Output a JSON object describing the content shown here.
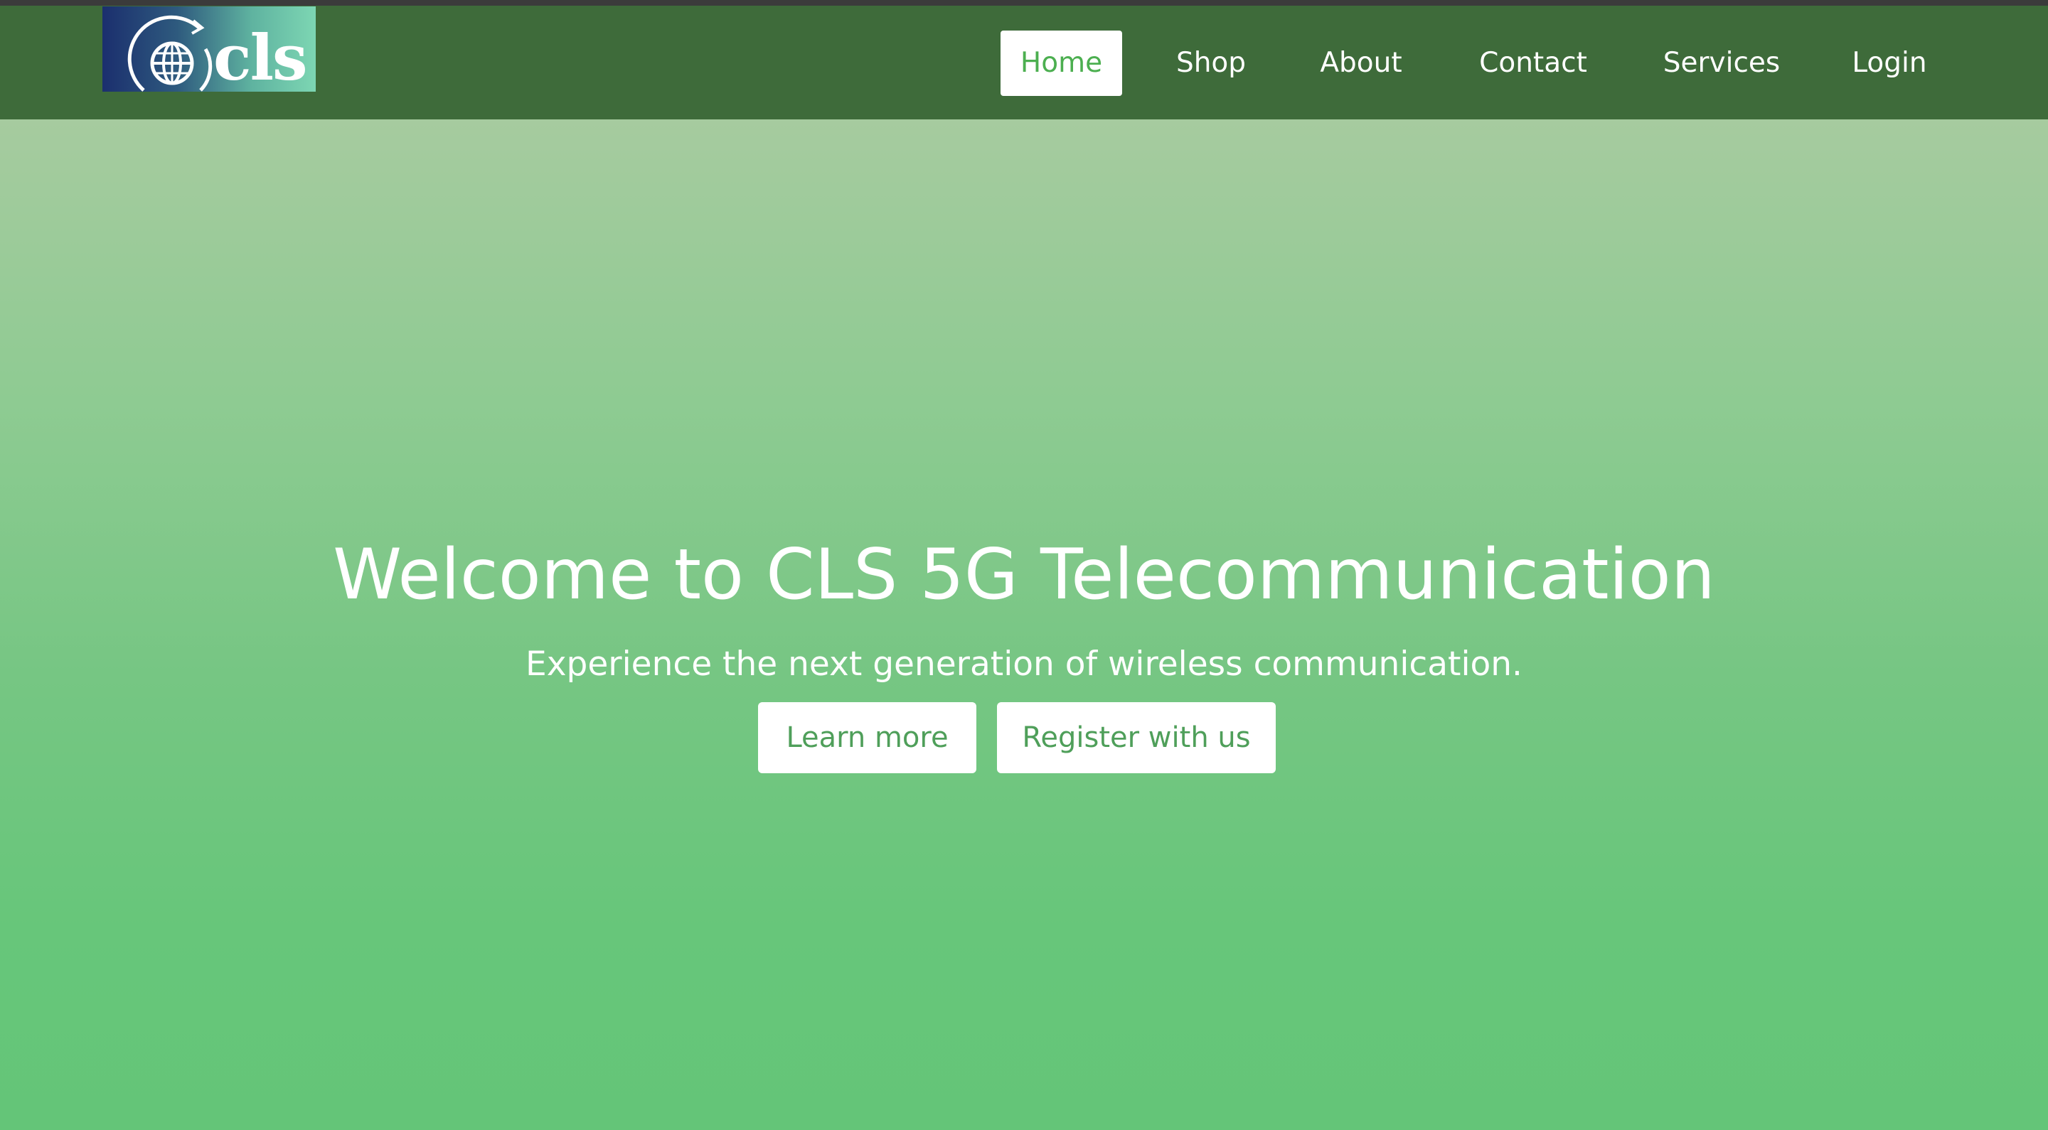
{
  "brand": {
    "logo_text": "cls",
    "logo_icon": "globe-icon"
  },
  "nav": {
    "items": [
      {
        "label": "Home",
        "active": true
      },
      {
        "label": "Shop",
        "active": false
      },
      {
        "label": "About",
        "active": false
      },
      {
        "label": "Contact",
        "active": false
      },
      {
        "label": "Services",
        "active": false
      },
      {
        "label": "Login",
        "active": false
      }
    ]
  },
  "hero": {
    "title": "Welcome to CLS 5G Telecommunication",
    "subtitle": "Experience the next generation of wireless communication.",
    "primary_button": "Learn more",
    "secondary_button": "Register with us"
  },
  "colors": {
    "navbar": "#3e6b3a",
    "accent": "#4caf50",
    "hero_top": "#a6cb9f",
    "hero_bottom": "#64c578"
  }
}
